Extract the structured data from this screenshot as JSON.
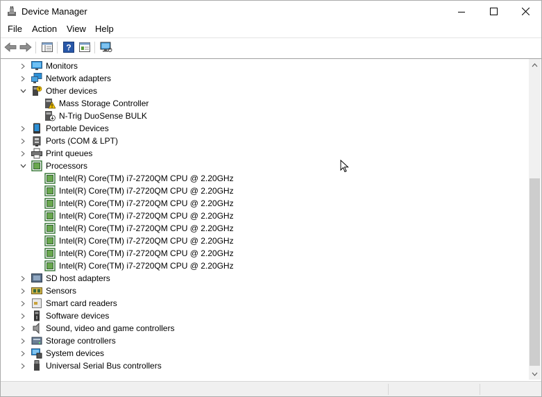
{
  "window": {
    "title": "Device Manager",
    "icon": "device-manager-icon"
  },
  "menu": [
    "File",
    "Action",
    "View",
    "Help"
  ],
  "toolbar": {
    "buttons": [
      "back-arrow-icon",
      "forward-arrow-icon",
      "properties-icon",
      "help-icon",
      "update-driver-icon",
      "scan-monitor-icon"
    ]
  },
  "tree": [
    {
      "label": "Monitors",
      "expanded": false,
      "icon": "monitor-icon"
    },
    {
      "label": "Network adapters",
      "expanded": false,
      "icon": "network-icon"
    },
    {
      "label": "Other devices",
      "expanded": true,
      "icon": "other-devices-icon",
      "children": [
        {
          "label": "Mass Storage Controller",
          "icon": "warning-device-icon"
        },
        {
          "label": "N-Trig DuoSense BULK",
          "icon": "warning-device-icon"
        }
      ]
    },
    {
      "label": "Portable Devices",
      "expanded": false,
      "icon": "portable-device-icon"
    },
    {
      "label": "Ports (COM & LPT)",
      "expanded": false,
      "icon": "port-icon"
    },
    {
      "label": "Print queues",
      "expanded": false,
      "icon": "printer-icon"
    },
    {
      "label": "Processors",
      "expanded": true,
      "icon": "processor-icon",
      "children": [
        {
          "label": "Intel(R) Core(TM) i7-2720QM CPU @ 2.20GHz",
          "icon": "processor-icon"
        },
        {
          "label": "Intel(R) Core(TM) i7-2720QM CPU @ 2.20GHz",
          "icon": "processor-icon"
        },
        {
          "label": "Intel(R) Core(TM) i7-2720QM CPU @ 2.20GHz",
          "icon": "processor-icon"
        },
        {
          "label": "Intel(R) Core(TM) i7-2720QM CPU @ 2.20GHz",
          "icon": "processor-icon"
        },
        {
          "label": "Intel(R) Core(TM) i7-2720QM CPU @ 2.20GHz",
          "icon": "processor-icon"
        },
        {
          "label": "Intel(R) Core(TM) i7-2720QM CPU @ 2.20GHz",
          "icon": "processor-icon"
        },
        {
          "label": "Intel(R) Core(TM) i7-2720QM CPU @ 2.20GHz",
          "icon": "processor-icon"
        },
        {
          "label": "Intel(R) Core(TM) i7-2720QM CPU @ 2.20GHz",
          "icon": "processor-icon"
        }
      ]
    },
    {
      "label": "SD host adapters",
      "expanded": false,
      "icon": "sd-adapter-icon"
    },
    {
      "label": "Sensors",
      "expanded": false,
      "icon": "sensor-icon"
    },
    {
      "label": "Smart card readers",
      "expanded": false,
      "icon": "smart-card-icon"
    },
    {
      "label": "Software devices",
      "expanded": false,
      "icon": "software-device-icon"
    },
    {
      "label": "Sound, video and game controllers",
      "expanded": false,
      "icon": "speaker-icon"
    },
    {
      "label": "Storage controllers",
      "expanded": false,
      "icon": "storage-icon"
    },
    {
      "label": "System devices",
      "expanded": false,
      "icon": "system-device-icon"
    },
    {
      "label": "Universal Serial Bus controllers",
      "expanded": false,
      "icon": "usb-icon"
    }
  ],
  "colors": {
    "processor_green": "#3c7a3c",
    "monitor_blue": "#2b8fd6",
    "warning_yellow": "#f3c300",
    "scroll_thumb": "#cdcdcd"
  }
}
